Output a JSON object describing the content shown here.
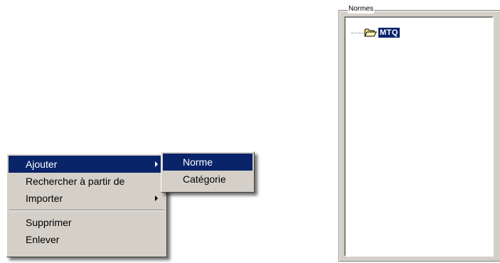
{
  "context_menu": {
    "items": [
      {
        "label": "Ajouter",
        "has_submenu": true,
        "highlighted": true
      },
      {
        "label": "Rechercher à partir de",
        "has_submenu": false,
        "highlighted": false
      },
      {
        "label": "Importer",
        "has_submenu": true,
        "highlighted": false
      }
    ],
    "items_after_separator": [
      {
        "label": "Supprimer"
      },
      {
        "label": "Enlever"
      }
    ]
  },
  "submenu": {
    "items": [
      {
        "label": "Norme",
        "highlighted": true
      },
      {
        "label": "Catégorie",
        "highlighted": false
      }
    ]
  },
  "normes_panel": {
    "title": "Normes",
    "tree": [
      {
        "label": "MTQ",
        "icon": "open-folder-icon",
        "selected": true
      }
    ]
  },
  "colors": {
    "selection": "#0a246a",
    "face": "#d4d0c8"
  }
}
